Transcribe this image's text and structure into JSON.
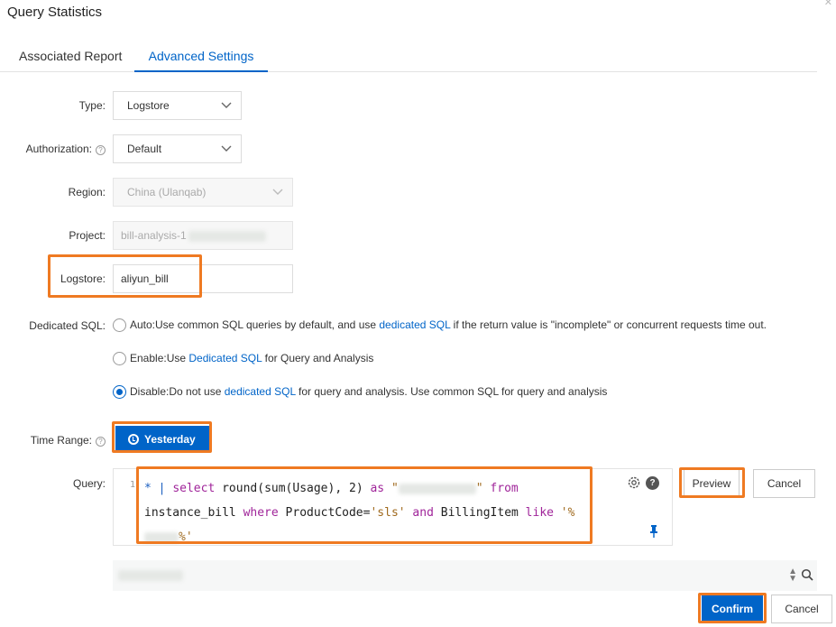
{
  "dialog": {
    "title": "Query Statistics"
  },
  "tabs": [
    {
      "label": "Associated Report",
      "active": false
    },
    {
      "label": "Advanced Settings",
      "active": true
    }
  ],
  "form": {
    "type": {
      "label": "Type:",
      "value": "Logstore"
    },
    "authorization": {
      "label": "Authorization:",
      "value": "Default"
    },
    "region": {
      "label": "Region:",
      "value": "China (Ulanqab)"
    },
    "project": {
      "label": "Project:",
      "value": "bill-analysis-1"
    },
    "logstore": {
      "label": "Logstore:",
      "value": "aliyun_bill"
    },
    "dedicated_sql": {
      "label": "Dedicated SQL:",
      "options": [
        {
          "prefix": "Auto:Use common SQL queries by default, and use ",
          "link": "dedicated SQL",
          "suffix": " if the return value is \"incomplete\" or concurrent requests time out.",
          "checked": false
        },
        {
          "prefix": "Enable:Use ",
          "link": "Dedicated SQL",
          "suffix": " for Query and Analysis",
          "checked": false
        },
        {
          "prefix": "Disable:Do not use ",
          "link": "dedicated SQL",
          "suffix": " for query and analysis. Use common SQL for query and analysis",
          "checked": true
        }
      ]
    },
    "time_range": {
      "label": "Time Range:",
      "button": "Yesterday"
    },
    "query": {
      "label": "Query:",
      "line_number": "1",
      "tokens": {
        "t1": "* | ",
        "t2": "select",
        "t3": " round(sum(Usage), 2) ",
        "t4": "as",
        "t5": " \"",
        "t6": "\"",
        "t7": " from",
        "t8": "instance_bill ",
        "t9": "where",
        "t10": " ProductCode=",
        "t11": "'sls'",
        "t12": " and",
        "t13": " BillingItem ",
        "t14": "like",
        "t15": " '%",
        "t16": "%'"
      }
    }
  },
  "buttons": {
    "preview": "Preview",
    "cancel_query": "Cancel",
    "confirm": "Confirm",
    "cancel": "Cancel"
  },
  "colors": {
    "accent": "#0064c8",
    "highlight": "#ef7a22"
  }
}
